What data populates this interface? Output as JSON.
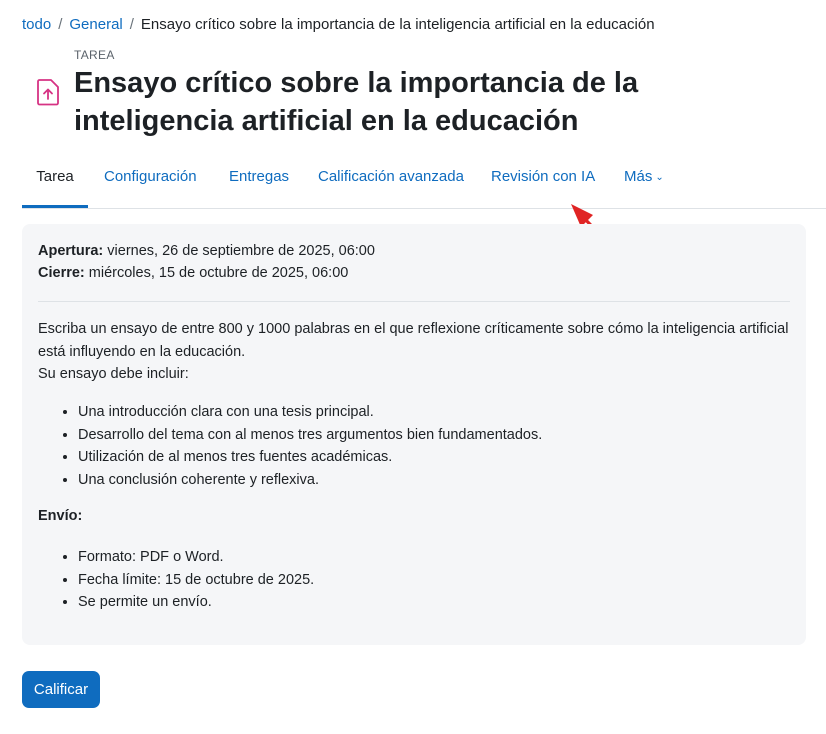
{
  "breadcrumb": {
    "items": [
      "todo",
      "General"
    ],
    "current": "Ensayo crítico sobre la importancia de la inteligencia artificial en la educación",
    "separator": "/"
  },
  "header": {
    "pretitle": "TAREA",
    "title": "Ensayo crítico sobre la importancia de la inteligencia artificial en la educación",
    "icon": "file-upload-icon",
    "icon_color": "#d63384"
  },
  "tabs": [
    {
      "label": "Tarea",
      "active": true
    },
    {
      "label": "Configuración"
    },
    {
      "label": "Entregas"
    },
    {
      "label": "Calificación avanzada"
    },
    {
      "label": "Revisión con IA"
    },
    {
      "label": "Más",
      "icon": "chevron-down-icon"
    }
  ],
  "annotation": {
    "icon": "red-arrow-icon",
    "color": "#e02424"
  },
  "details": {
    "opening_label": "Apertura:",
    "opening_value": " viernes, 26 de septiembre de 2025, 06:00",
    "closing_label": "Cierre:",
    "closing_value": " miércoles, 15 de octubre de 2025, 06:00"
  },
  "description": {
    "paragraph": "Escriba un ensayo de entre 800 y 1000 palabras en el que reflexione críticamente sobre cómo la inteligencia artificial está influyendo en la educación.",
    "must_include": "Su ensayo debe incluir:",
    "items": [
      "Una introducción clara con una tesis principal.",
      "Desarrollo del tema con al menos tres argumentos bien fundamentados.",
      "Utilización de al menos tres fuentes académicas.",
      "Una conclusión coherente y reflexiva."
    ],
    "submission_heading": "Envío:",
    "submission_items": [
      "Formato: PDF o Word.",
      "Fecha límite: 15 de octubre de 2025.",
      "Se permite un envío."
    ]
  },
  "actions": {
    "grade_button": "Calificar"
  },
  "colors": {
    "accent": "#0f6cbf",
    "card_bg": "#f5f6f8",
    "text": "#1d2125"
  }
}
